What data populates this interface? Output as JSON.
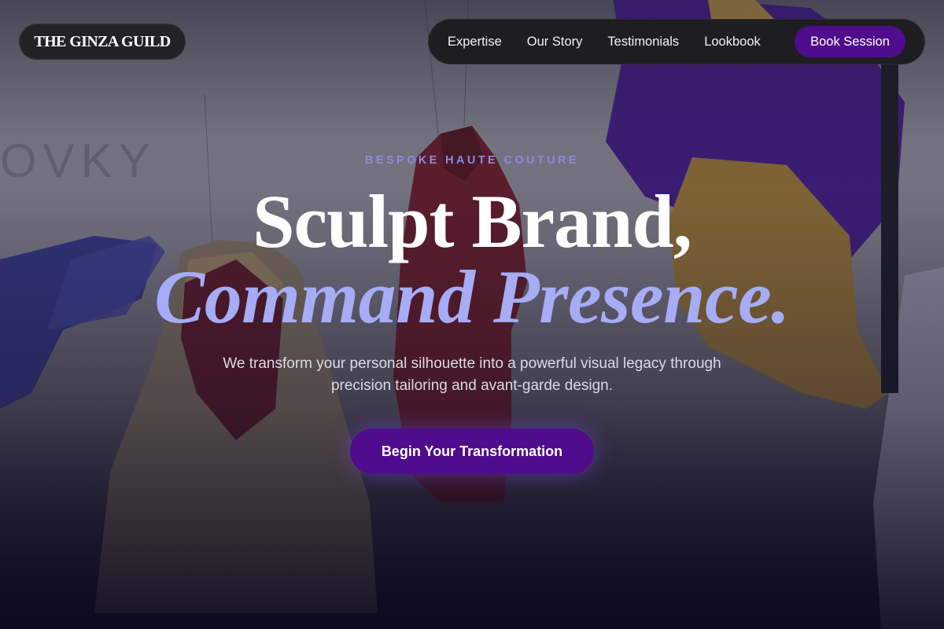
{
  "brand": {
    "logo_text": "THE GINZA GUILD"
  },
  "nav": {
    "items": [
      {
        "label": "Expertise"
      },
      {
        "label": "Our Story"
      },
      {
        "label": "Testimonials"
      },
      {
        "label": "Lookbook"
      }
    ],
    "cta_label": "Book Session"
  },
  "hero": {
    "eyebrow": "BESPOKE HAUTE COUTURE",
    "headline_line1": "Sculpt Brand,",
    "headline_line2": "Command Presence.",
    "lede": "We transform your personal silhouette into a powerful visual legacy through precision tailoring and avant-garde design.",
    "cta_label": "Begin Your Transformation"
  },
  "colors": {
    "accent": "#4f0c8c",
    "headline_accent": "#a6acf5",
    "eyebrow": "#8e88e0"
  }
}
